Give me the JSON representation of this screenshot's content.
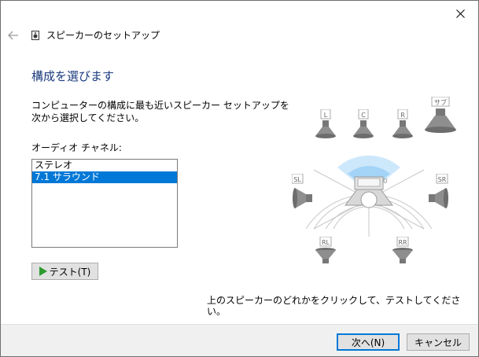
{
  "window": {
    "title": "スピーカーのセットアップ"
  },
  "page": {
    "heading": "構成を選びます",
    "instruction": "コンピューターの構成に最も近いスピーカー セットアップを次から選択してください。",
    "channel_label": "オーディオ チャネル:",
    "channels": [
      {
        "label": "ステレオ",
        "selected": false
      },
      {
        "label": "7.1 サラウンド",
        "selected": true
      }
    ],
    "test_button": "テスト(T)",
    "hint": "上のスピーカーのどれかをクリックして、テストしてください。"
  },
  "speakers": {
    "front_left": "L",
    "center": "C",
    "front_right": "R",
    "subwoofer": "サブ",
    "side_left": "SL",
    "side_right": "SR",
    "rear_left": "RL",
    "rear_right": "RR"
  },
  "footer": {
    "next": "次へ(N)",
    "cancel": "キャンセル"
  },
  "colors": {
    "accent": "#0078d7",
    "heading": "#1b3b7e",
    "play": "#2e9b2e"
  }
}
